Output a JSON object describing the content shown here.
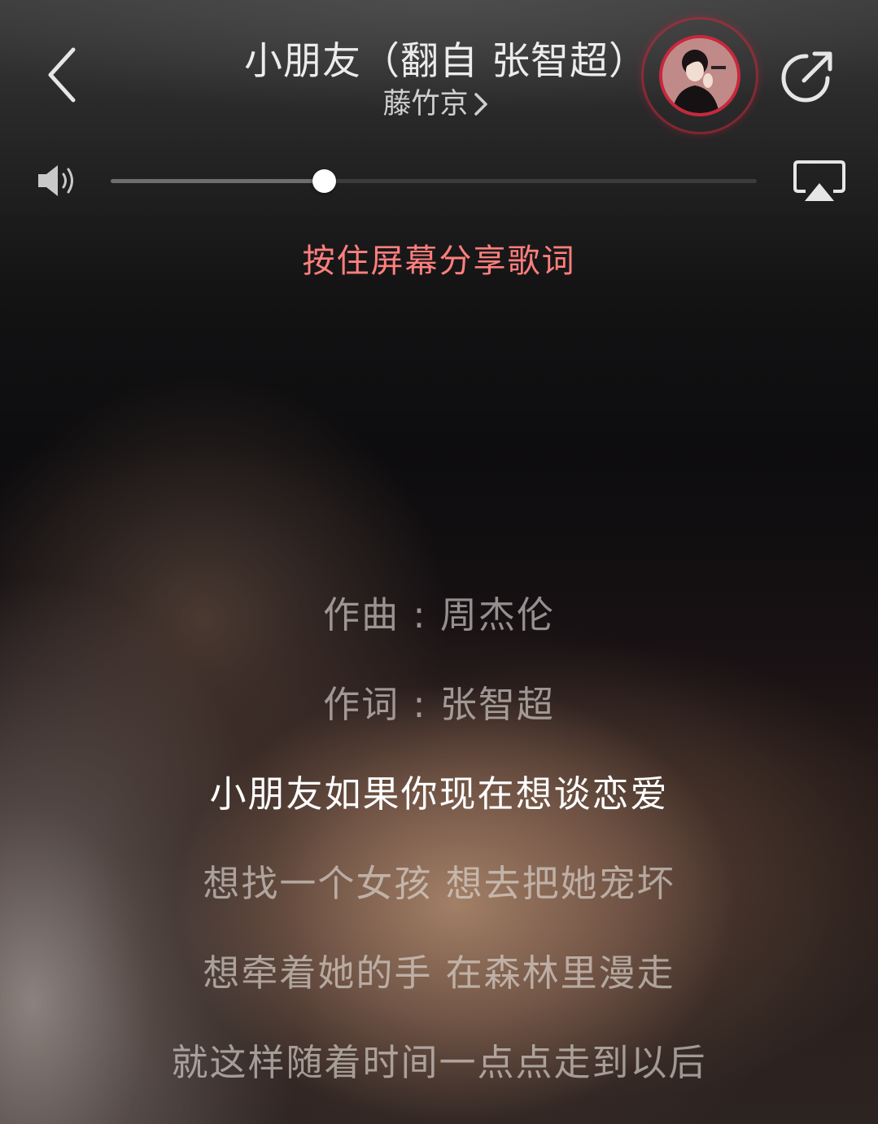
{
  "header": {
    "song_title": "小朋友（翻自 张智超）",
    "artist": "藤竹京",
    "back_icon": "chevron-left-icon",
    "share_icon": "share-icon",
    "avatar_ring_color": "#c8283c"
  },
  "volume": {
    "level": 0.33,
    "speaker_icon": "speaker-icon",
    "airplay_icon": "airplay-icon"
  },
  "share_hint": "按住屏幕分享歌词",
  "colors": {
    "hint": "#ff7f7d",
    "lyric_current": "#ffffff",
    "lyric_dim": "rgba(228,222,218,0.62)"
  },
  "lyrics": {
    "current_index": 2,
    "lines": [
      "作曲 : 周杰伦",
      "作词 : 张智超",
      "小朋友如果你现在想谈恋爱",
      "想找一个女孩 想去把她宠坏",
      "想牵着她的手 在森林里漫走",
      "就这样随着时间一点点走到以后"
    ]
  }
}
